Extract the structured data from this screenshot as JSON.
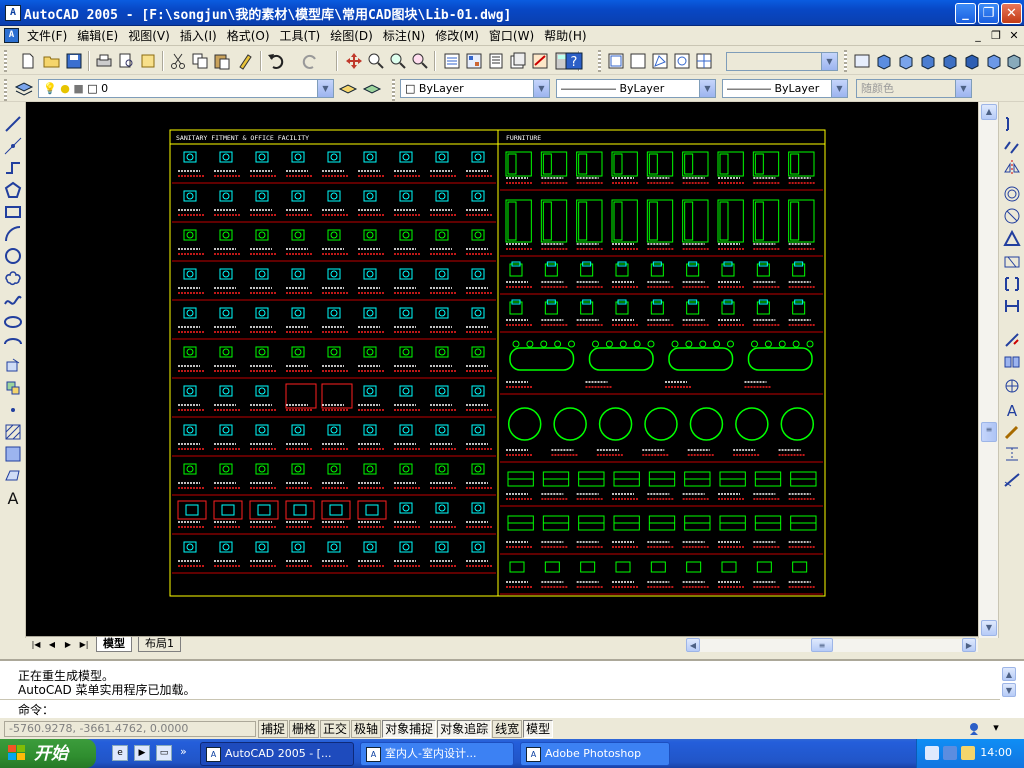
{
  "window": {
    "app_icon": "autocad-app-icon",
    "title": "AutoCAD 2005 - [F:\\songjun\\我的素材\\模型库\\常用CAD图块\\Lib-01.dwg]",
    "controls": {
      "minimize": "_",
      "restore": "❐",
      "close": "✕"
    }
  },
  "menu": {
    "items": [
      "文件(F)",
      "编辑(E)",
      "视图(V)",
      "插入(I)",
      "格式(O)",
      "工具(T)",
      "绘图(D)",
      "标注(N)",
      "修改(M)",
      "窗口(W)",
      "帮助(H)"
    ],
    "doc_controls": {
      "minimize": "_",
      "restore": "❐",
      "close": "✕"
    }
  },
  "properties_toolbar": {
    "layer_value": "0",
    "color_value": "ByLayer",
    "linetype_value": "ByLayer",
    "lineweight_value": "ByLayer",
    "plotstyle_value": "随颜色"
  },
  "drawing": {
    "left_header": "SANITARY FITMENT & OFFICE FACILITY",
    "right_header": "FURNITURE",
    "colors": {
      "background": "#000000",
      "frame": "#ffff00",
      "symbols_cyan": "#00ffff",
      "symbols_green": "#00ff00",
      "labels_red": "#ff2020",
      "labels_white": "#ffffff",
      "divider_red": "#ff0000"
    }
  },
  "layout_tabs": {
    "model": "模型",
    "layout1": "布局1"
  },
  "command": {
    "history": [
      "正在重生成模型。",
      "AutoCAD 菜单实用程序已加载。"
    ],
    "prompt": "命令："
  },
  "status": {
    "coords": "-5760.9278, -3661.4762, 0.0000",
    "toggles": [
      {
        "label": "捕捉",
        "on": false
      },
      {
        "label": "栅格",
        "on": false
      },
      {
        "label": "正交",
        "on": false
      },
      {
        "label": "极轴",
        "on": false
      },
      {
        "label": "对象捕捉",
        "on": true
      },
      {
        "label": "对象追踪",
        "on": true
      },
      {
        "label": "线宽",
        "on": false
      },
      {
        "label": "模型",
        "on": true
      }
    ]
  },
  "taskbar": {
    "start": "开始",
    "tasks": [
      {
        "label": "AutoCAD 2005 - [...",
        "icon": "autocad-icon",
        "active": true
      },
      {
        "label": "室内人-室内设计...",
        "icon": "ie-icon",
        "active": false
      },
      {
        "label": "Adobe Photoshop",
        "icon": "photoshop-icon",
        "active": false
      }
    ],
    "clock": "14:00"
  }
}
